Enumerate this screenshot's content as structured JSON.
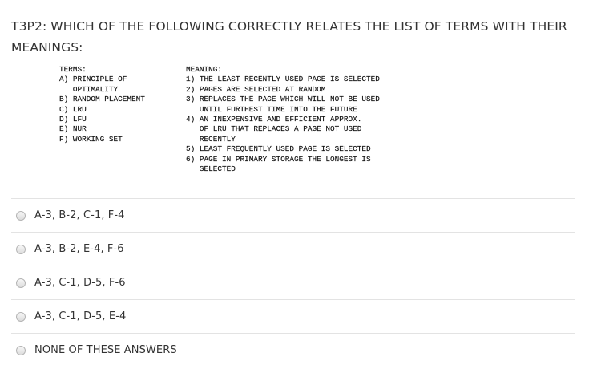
{
  "question": {
    "title": "T3P2: WHICH OF THE FOLLOWING CORRECTLY RELATES THE LIST OF TERMS WITH THEIR MEANINGS:"
  },
  "table": {
    "terms_lines": [
      "TERMS:",
      "A) PRINCIPLE OF",
      "   OPTIMALITY",
      "B) RANDOM PLACEMENT",
      "C) LRU",
      "D) LFU",
      "E) NUR",
      "F) WORKING SET"
    ],
    "meaning_lines": [
      "MEANING:",
      "1) THE LEAST RECENTLY USED PAGE IS SELECTED",
      "2) PAGES ARE SELECTED AT RANDOM",
      "3) REPLACES THE PAGE WHICH WILL NOT BE USED",
      "   UNTIL FURTHEST TIME INTO THE FUTURE",
      "4) AN INEXPENSIVE AND EFFICIENT APPROX.",
      "   OF LRU THAT REPLACES A PAGE NOT USED",
      "   RECENTLY",
      "5) LEAST FREQUENTLY USED PAGE IS SELECTED",
      "6) PAGE IN PRIMARY STORAGE THE LONGEST IS",
      "   SELECTED"
    ]
  },
  "answers": [
    {
      "label": "A-3, B-2, C-1, F-4"
    },
    {
      "label": "A-3, B-2, E-4, F-6"
    },
    {
      "label": "A-3, C-1, D-5, F-6"
    },
    {
      "label": "A-3, C-1, D-5, E-4"
    },
    {
      "label": "NONE OF THESE ANSWERS"
    }
  ]
}
